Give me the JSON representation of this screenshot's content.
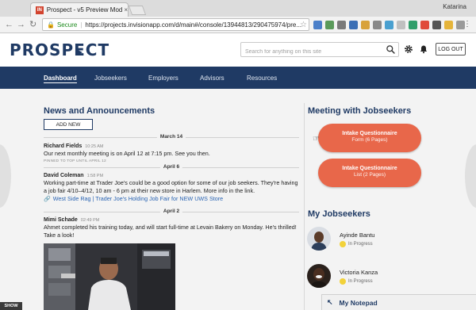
{
  "browser": {
    "tab_title": "Prospect - v5 Preview Mode -",
    "tab_favicon": "IN",
    "tab_close": "×",
    "profile_name": "Katarina",
    "secure_label": "Secure",
    "url": "https://projects.invisionapp.com/d/main#/console/13944813/290475974/pre..."
  },
  "header": {
    "logo_text": "PROSPECT",
    "search_placeholder": "Search for anything on this site",
    "logout_label": "LOG OUT"
  },
  "nav": {
    "items": [
      {
        "label": "Dashboard",
        "active": true
      },
      {
        "label": "Jobseekers"
      },
      {
        "label": "Employers"
      },
      {
        "label": "Advisors"
      },
      {
        "label": "Resources"
      }
    ]
  },
  "news": {
    "title": "News and Announcements",
    "add_new_label": "ADD NEW",
    "dates": [
      "March 14",
      "April 6",
      "April 2"
    ],
    "posts": [
      {
        "author": "Richard Fields",
        "time": "10:25 AM",
        "body": "Our next monthly meeting is on April 12 at 7:15 pm. See you then.",
        "pinned": "PINNED TO TOP UNTIL APRIL 12"
      },
      {
        "author": "David Coleman",
        "time": "1:58 PM",
        "body": "Working part-time at Trader Joe's could be a good option for some of our job seekers. They're having a job fair 4/10–4/12, 10 am - 6 pm at their new store in Harlem. More info in the link.",
        "link": "West Side Rag | Trader Joe's Holding Job Fair for NEW UWS Store"
      },
      {
        "author": "Mimi Schade",
        "time": "02:49 PM",
        "body": "Ahmet completed his training today, and will start full-time at Levain Bakery on Monday. He's thrilled! Take a look!"
      }
    ]
  },
  "meetings": {
    "title": "Meeting with Jobseekers",
    "buttons": [
      {
        "line1": "Intake Questionnaire",
        "line2": "Form (6 Pages)"
      },
      {
        "line1": "Intake Questionnaire",
        "line2": "List (2 Pages)"
      }
    ]
  },
  "jobseekers": {
    "title": "My Jobseekers",
    "items": [
      {
        "name": "Ayinde Bantu",
        "status": "In Progress"
      },
      {
        "name": "Victoria Kanza",
        "status": "In Progress"
      }
    ]
  },
  "notepad": {
    "label": "My Notepad",
    "arrow": "↖"
  },
  "show_label": "SHOW",
  "colors": {
    "brand_navy": "#1f3a64",
    "cta_orange": "#e8674a",
    "status_yellow": "#f2d23a",
    "link_blue": "#2a64b3"
  }
}
